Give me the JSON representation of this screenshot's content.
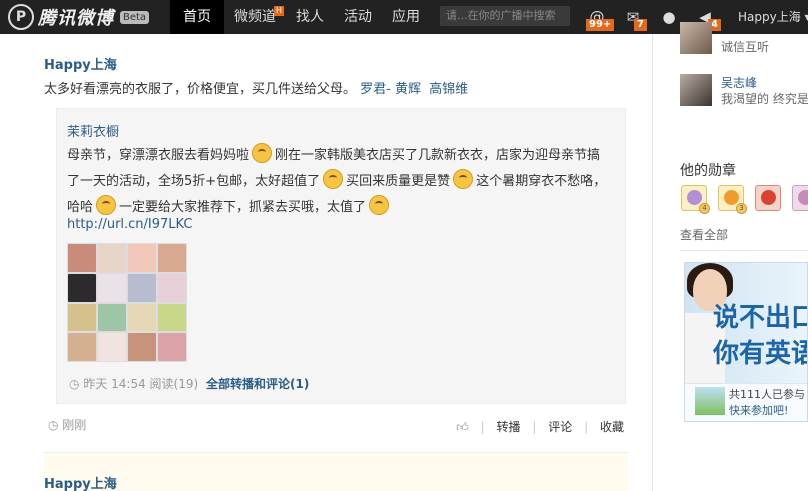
{
  "topbar": {
    "logo_letter": "P",
    "logo_text": "腾讯微博",
    "beta_label": "Beta",
    "nav": [
      {
        "label": "首页",
        "active": true
      },
      {
        "label": "微频道",
        "badge": "H"
      },
      {
        "label": "找人"
      },
      {
        "label": "活动"
      },
      {
        "label": "应用"
      }
    ],
    "search_placeholder": "请...在你的广播中搜索",
    "icons": {
      "at_badge": "99+",
      "mail_badge": "7",
      "sound_badge": "4"
    },
    "user_label": "Happy上海 ▾"
  },
  "post": {
    "author": "Happy上海",
    "text": "太多好看漂亮的衣服了，价格便宜，买几件送给父母。",
    "mentions": [
      "罗君- 黄辉",
      "高锦维"
    ],
    "quote": {
      "author": "茉莉衣橱",
      "text_parts": [
        "母亲节，穿漂漂衣服去看妈妈啦",
        "刚在一家韩版美衣店买了几款新衣衣，店家为迎母亲节搞了一天的活动，全场5折+包邮，太好超值了",
        "买回来质量更是赞",
        "这个暑期穿衣不愁咯，哈哈",
        "一定要给大家推荐下，抓紧去买哦，太值了"
      ],
      "link": "http://url.cn/I97LKC",
      "time": "昨天  14:54",
      "reads": "阅读(19)",
      "all_link": "全部转播和评论(1)"
    },
    "time": "刚刚",
    "actions": [
      "转播",
      "评论",
      "收藏"
    ]
  },
  "next_post": {
    "author": "Happy上海"
  },
  "sidebar": {
    "people": [
      {
        "name": "",
        "desc": "诚信互听"
      },
      {
        "name": "吴志峰",
        "desc": "我渴望的 终究是"
      }
    ],
    "medals_title": "他的勋章",
    "medal_counts": [
      "4",
      "3",
      "",
      ""
    ],
    "view_all": "查看全部",
    "ad": {
      "line1": "说不出口",
      "line2": "你有英语",
      "count_text": "共111人已参与",
      "cta": "快来参加吧!"
    }
  }
}
